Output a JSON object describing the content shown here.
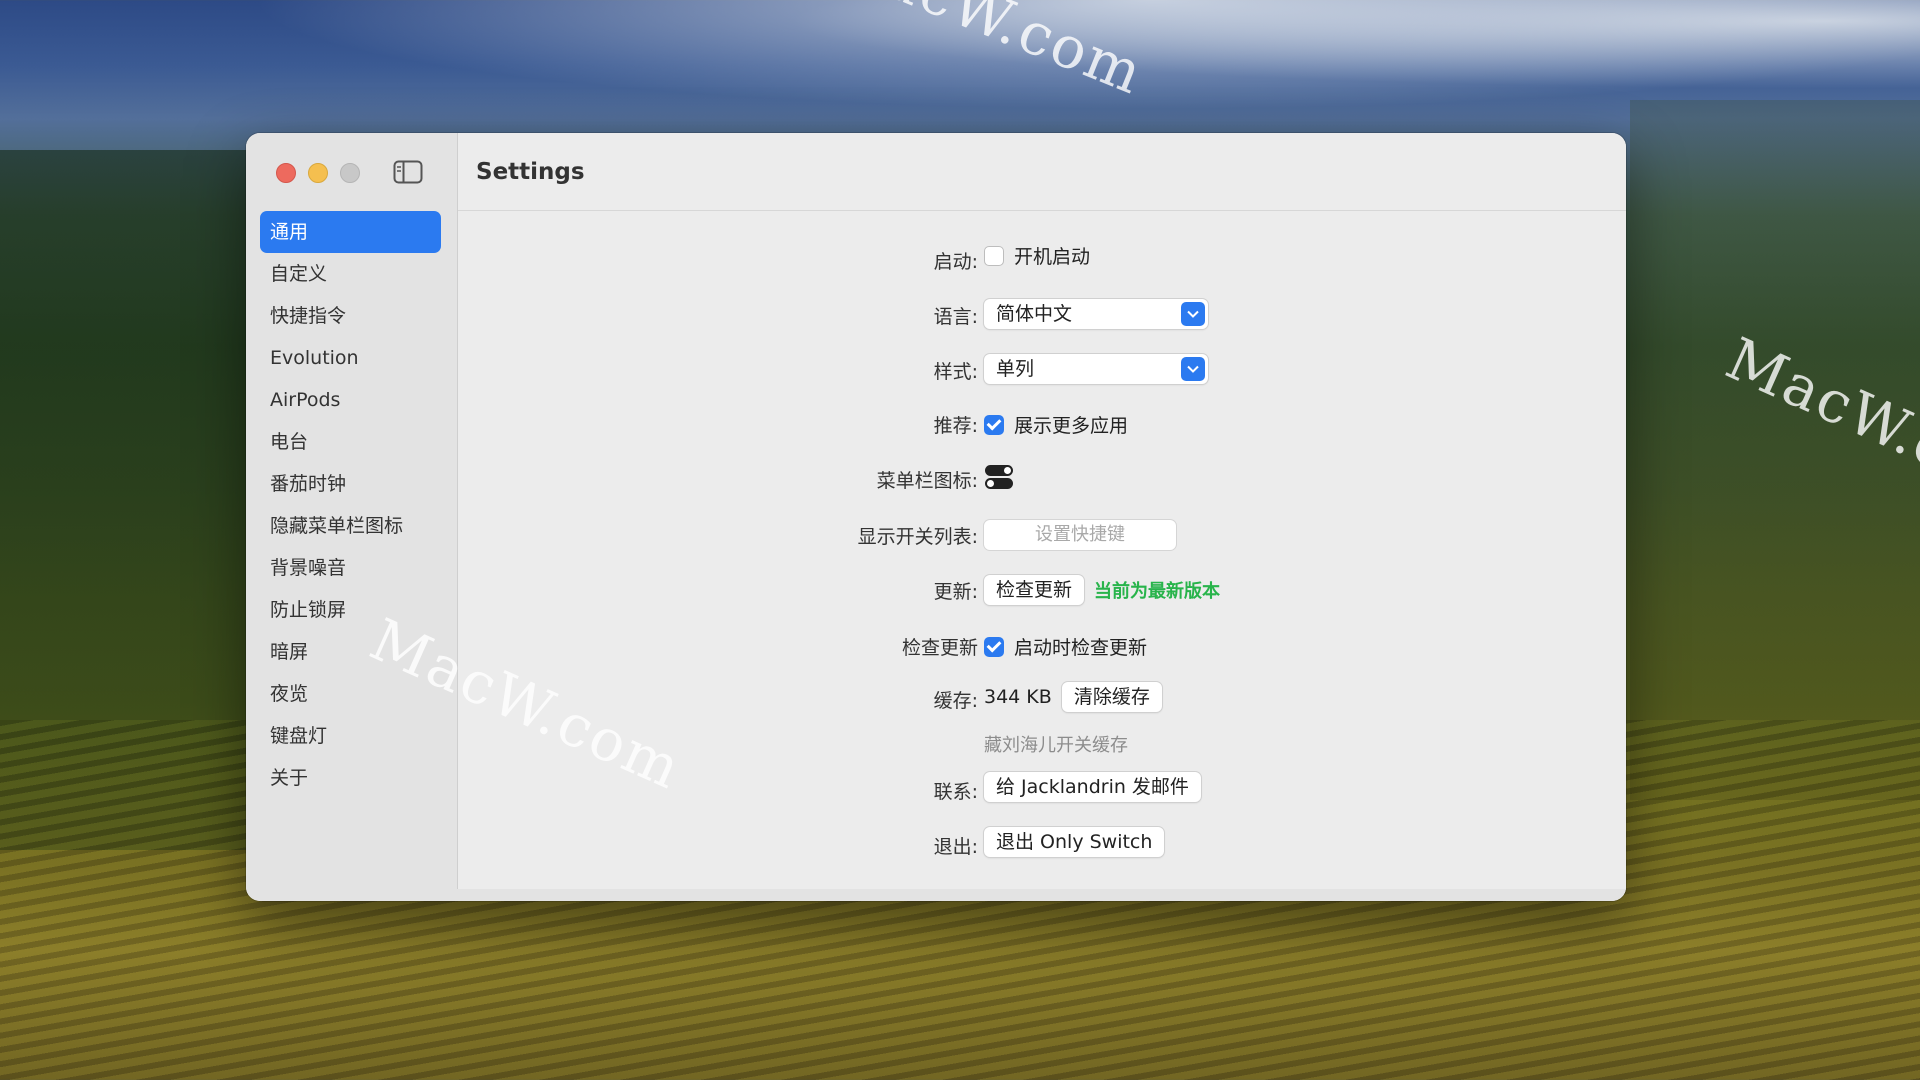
{
  "watermarks": [
    "MacW.com",
    "MacW.com",
    "MacW.c"
  ],
  "window": {
    "title": "Settings",
    "sidebar": {
      "items": [
        {
          "label": "通用",
          "active": true
        },
        {
          "label": "自定义"
        },
        {
          "label": "快捷指令"
        },
        {
          "label": "Evolution"
        },
        {
          "label": "AirPods"
        },
        {
          "label": "电台"
        },
        {
          "label": "番茄时钟"
        },
        {
          "label": "隐藏菜单栏图标"
        },
        {
          "label": "背景噪音"
        },
        {
          "label": "防止锁屏"
        },
        {
          "label": "暗屏"
        },
        {
          "label": "夜览"
        },
        {
          "label": "键盘灯"
        },
        {
          "label": "关于"
        }
      ]
    }
  },
  "settings": {
    "startup": {
      "label": "启动:",
      "checkbox_label": "开机启动",
      "checked": false
    },
    "language": {
      "label": "语言:",
      "value": "简体中文"
    },
    "style": {
      "label": "样式:",
      "value": "单列"
    },
    "recommend": {
      "label": "推荐:",
      "checkbox_label": "展示更多应用",
      "checked": true
    },
    "menubar_icon": {
      "label": "菜单栏图标:",
      "icon": "toggle-switch-icon"
    },
    "show_list": {
      "label": "显示开关列表:",
      "placeholder": "设置快捷键"
    },
    "update": {
      "label": "更新:",
      "button": "检查更新",
      "status": "当前为最新版本"
    },
    "check_update": {
      "label": "检查更新",
      "checkbox_label": "启动时检查更新",
      "checked": true
    },
    "cache": {
      "label": "缓存:",
      "size": "344 KB",
      "button": "清除缓存",
      "note": "藏刘海儿开关缓存"
    },
    "contact": {
      "label": "联系:",
      "button": "给 Jacklandrin 发邮件"
    },
    "quit": {
      "label": "退出:",
      "button": "退出 Only Switch"
    }
  },
  "colors": {
    "accent": "#2b7af0",
    "status_green": "#28b44b"
  }
}
